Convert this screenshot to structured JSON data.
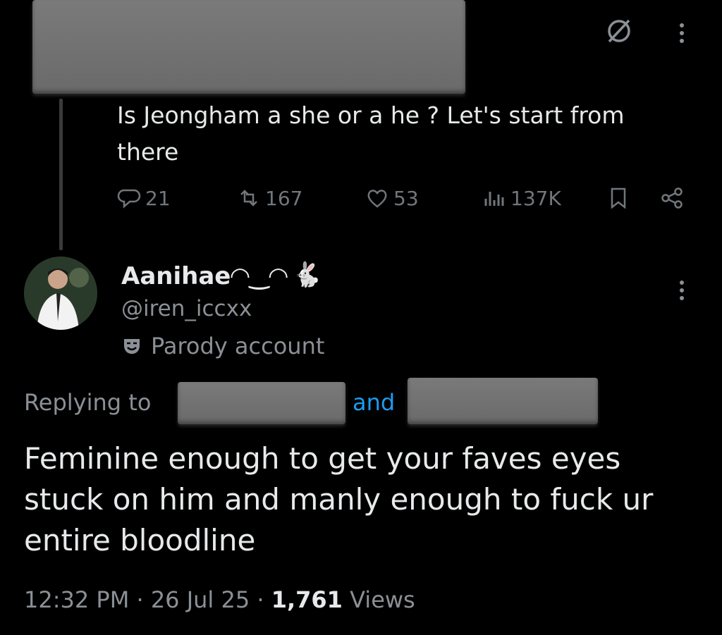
{
  "quoted_tweet": {
    "text": "Is Jeongham a she or a he ? Let's start from there",
    "replies": "21",
    "retweets": "167",
    "likes": "53",
    "views": "137K"
  },
  "reply": {
    "display_name": "Aanihae◠‿◠",
    "emoji": "🐇",
    "handle": "@iren_iccxx",
    "parody_label": "Parody account",
    "replying_to_label": "Replying to",
    "and_label": "and",
    "text": "Feminine enough to get your faves eyes stuck on him and manly enough to fuck ur entire bloodline",
    "time": "12:32 PM",
    "date": "26 Jul 25",
    "views_count": "1,761",
    "views_label": "Views"
  },
  "colors": {
    "background": "#000000",
    "text": "#e7e9ea",
    "muted": "#71767b",
    "link": "#1d9bf0"
  },
  "icons": [
    "grok-icon",
    "more-icon",
    "reply-icon",
    "retweet-icon",
    "like-icon",
    "views-icon",
    "bookmark-icon",
    "share-icon",
    "parody-mask-icon"
  ]
}
